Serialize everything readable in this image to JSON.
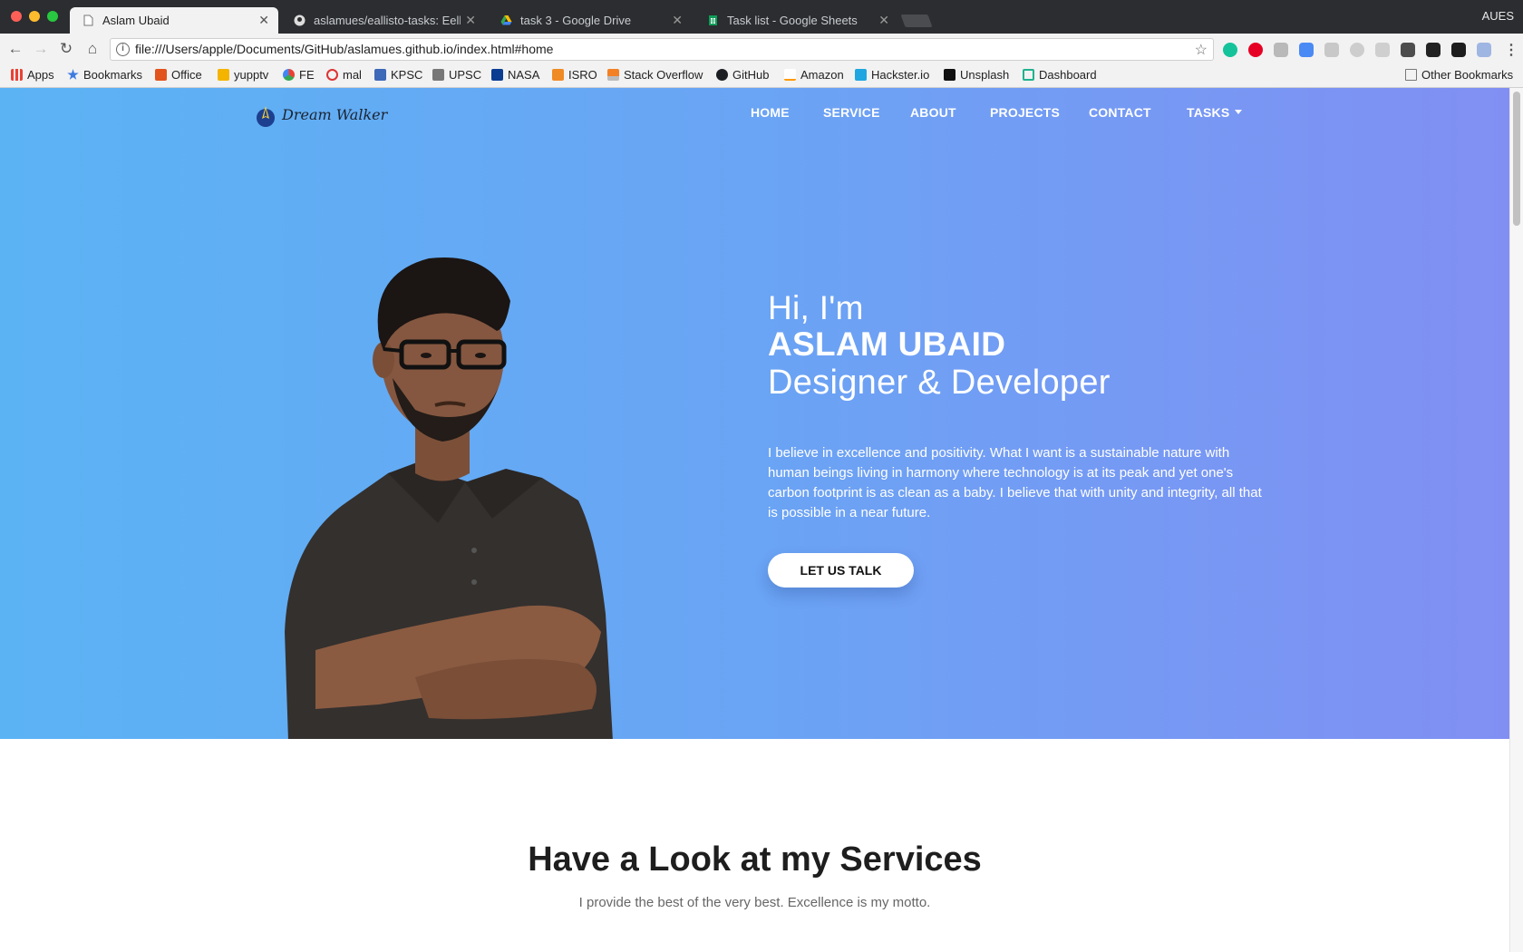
{
  "browser": {
    "profile": "AUES",
    "tabs": [
      {
        "title": "Aslam Ubaid",
        "active": true
      },
      {
        "title": "aslamues/eallisto-tasks: Eellisto",
        "active": false
      },
      {
        "title": "task 3 - Google Drive",
        "active": false
      },
      {
        "title": "Task list - Google Sheets",
        "active": false
      }
    ],
    "url": "file:///Users/apple/Documents/GitHub/aslamues.github.io/index.html#home",
    "bookmarks": [
      "Apps",
      "Bookmarks",
      "Office",
      "yupptv",
      "FE",
      "mal",
      "KPSC",
      "UPSC",
      "NASA",
      "ISRO",
      "Stack Overflow",
      "GitHub",
      "Amazon",
      "Hackster.io",
      "Unsplash",
      "Dashboard"
    ],
    "other_bookmarks": "Other Bookmarks"
  },
  "site": {
    "logo_text": "Dream Walker",
    "nav": [
      "HOME",
      "SERVICE",
      "ABOUT",
      "PROJECTS",
      "CONTACT",
      "TASKS"
    ],
    "hero": {
      "greeting": "Hi, I'm",
      "name": "ASLAM UBAID",
      "role": "Designer & Developer",
      "bio": "I believe in excellence and positivity. What I want is a sustainable nature with human beings living in harmony where technology is at its peak and yet one's carbon footprint is as clean as a baby. I believe that with unity and integrity, all that is possible in a near future.",
      "cta": "LET US TALK"
    },
    "services": {
      "title": "Have a Look at my Services",
      "subtitle": "I provide the best of the very best. Excellence is my motto."
    }
  },
  "colors": {
    "hero_gradient_start": "#5bb3f4",
    "hero_gradient_end": "#818ff3",
    "chrome_dark": "#2b2d30",
    "toolbar": "#f2f2f2"
  }
}
